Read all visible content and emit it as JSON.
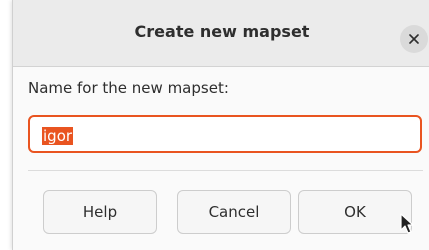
{
  "dialog": {
    "title": "Create new mapset",
    "close_icon": "close-icon",
    "field_label": "Name for the new mapset:",
    "field_value": "igor",
    "buttons": {
      "help": "Help",
      "cancel": "Cancel",
      "ok": "OK"
    }
  },
  "colors": {
    "accent": "#e95420",
    "titlebar": "#ebebeb",
    "background": "#fafafa"
  },
  "pointer_icon": "arrow-cursor-icon"
}
